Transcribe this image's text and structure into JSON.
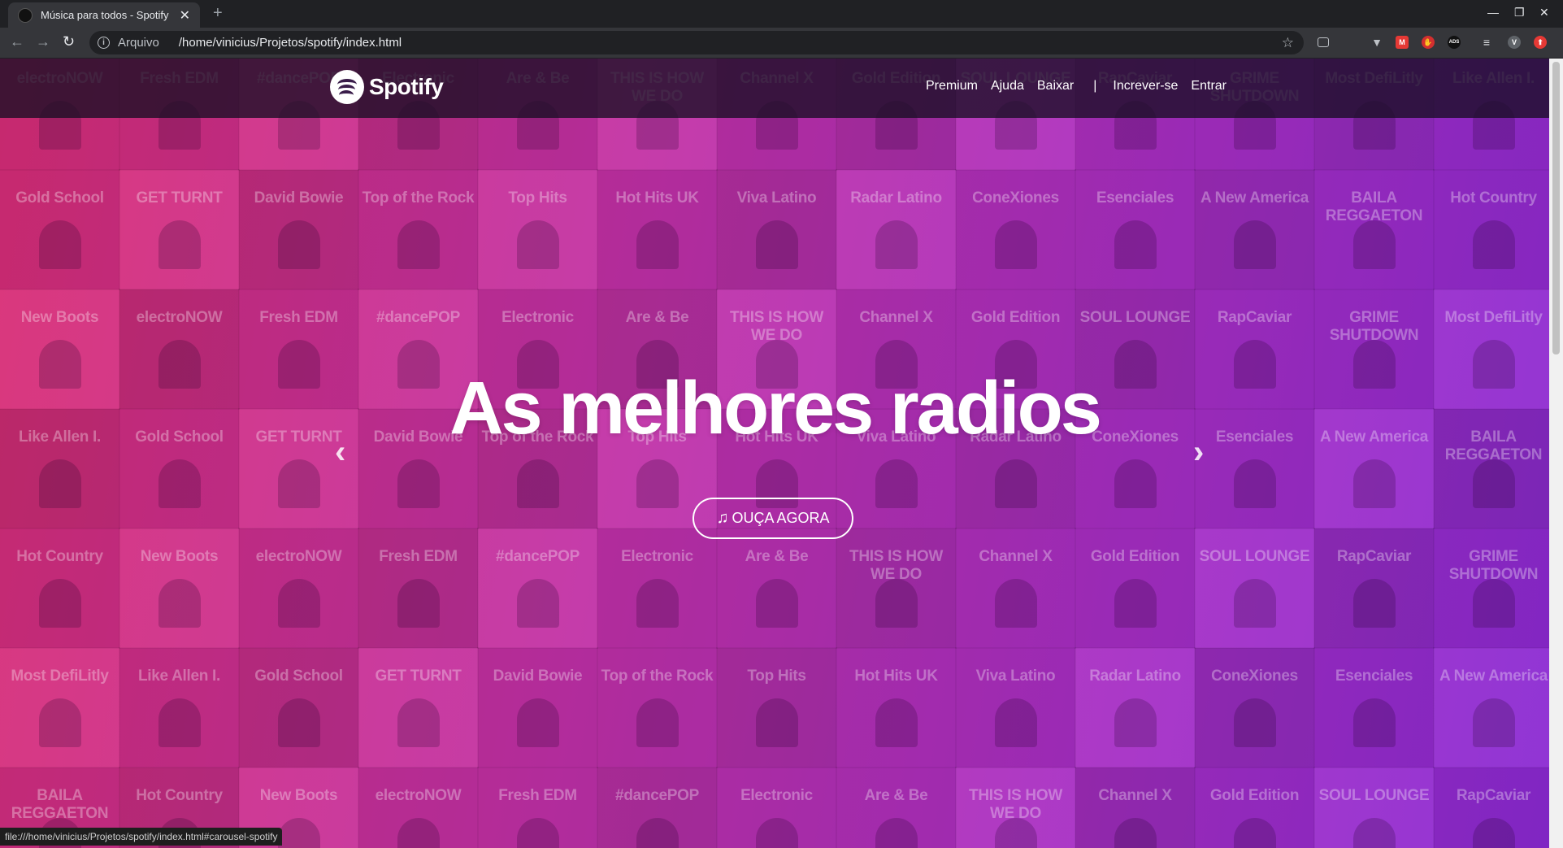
{
  "browser": {
    "tab_title": "Música para todos - Spotify",
    "new_tab": "+",
    "scheme_label": "Arquivo",
    "url": "/home/vinicius/Projetos/spotify/index.html",
    "status_url": "file:///home/vinicius/Projetos/spotify/index.html#carousel-spotify",
    "profile_initial": "V"
  },
  "header": {
    "brand": "Spotify",
    "nav": [
      "Premium",
      "Ajuda",
      "Baixar",
      "Increver-se",
      "Entrar"
    ],
    "separator": "|"
  },
  "hero": {
    "headline": "As melhores radios",
    "cta_label": "OUÇA AGORA"
  },
  "background_tiles": [
    "electroNOW",
    "Fresh EDM",
    "#dancePOP",
    "Electronic",
    "Are & Be",
    "THIS IS HOW WE DO",
    "Channel X",
    "Gold Edition",
    "SOUL LOUNGE",
    "RapCaviar",
    "GRIME SHUTDOWN",
    "Most DefiLitly",
    "Like Allen I.",
    "Gold School",
    "GET TURNT",
    "David Bowie",
    "Top of the Rock",
    "Top Hits",
    "Hot Hits UK",
    "Viva Latino",
    "Radar Latino",
    "ConeXiones",
    "Esenciales",
    "A New America",
    "BAILA REGGAETON",
    "Hot Country",
    "New Boots"
  ]
}
